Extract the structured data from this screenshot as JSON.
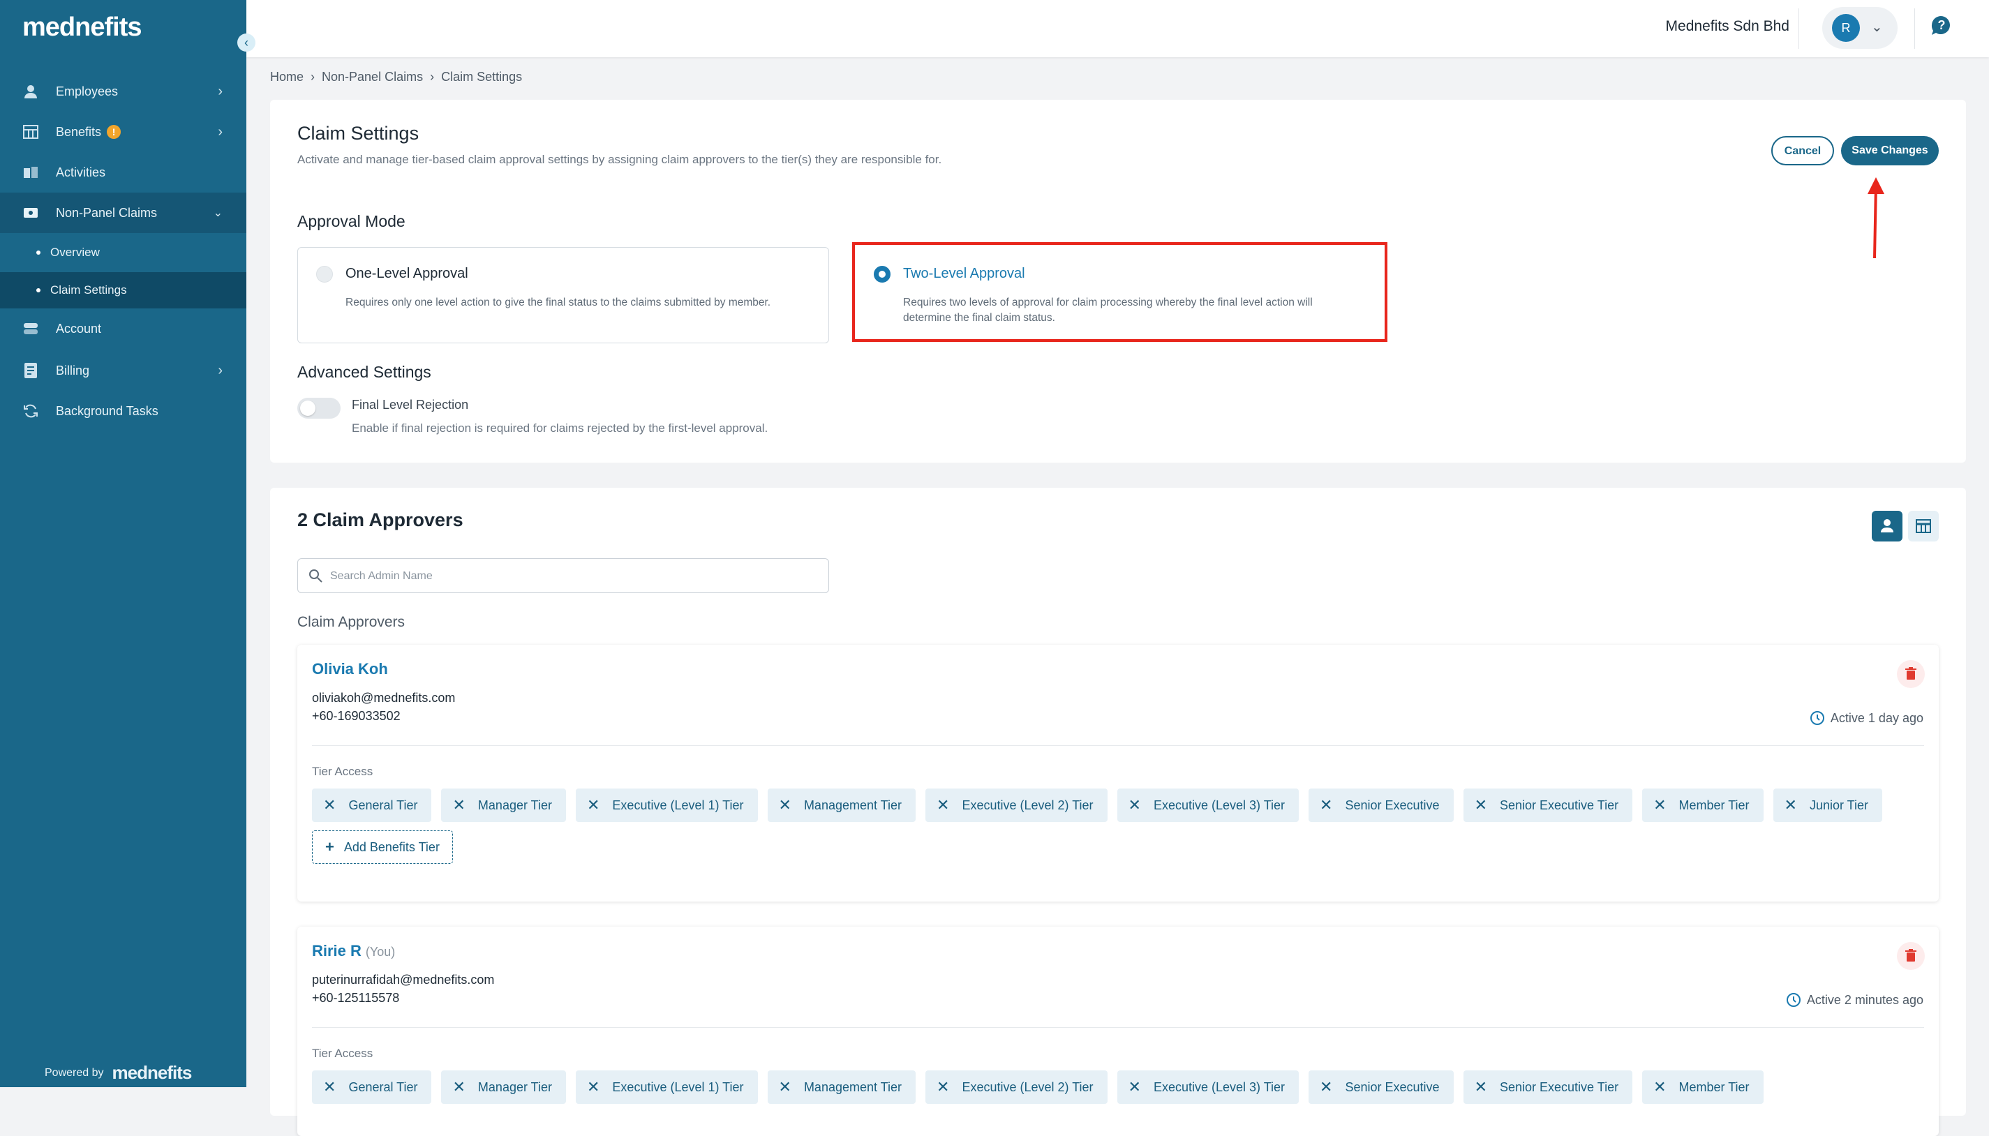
{
  "app": {
    "logo_text": "mednefits",
    "powered_by": "Powered by",
    "powered_brand": "mednefits"
  },
  "sidebar": {
    "items": [
      {
        "label": "Employees",
        "icon": "user-icon"
      },
      {
        "label": "Benefits",
        "icon": "benefits-icon",
        "badge": "!"
      },
      {
        "label": "Activities",
        "icon": "activities-icon"
      },
      {
        "label": "Non-Panel Claims",
        "icon": "wallet-icon"
      },
      {
        "label": "Account",
        "icon": "account-icon"
      },
      {
        "label": "Billing",
        "icon": "billing-icon"
      },
      {
        "label": "Background Tasks",
        "icon": "refresh-icon"
      }
    ],
    "subitems": [
      {
        "label": "Overview"
      },
      {
        "label": "Claim Settings"
      }
    ]
  },
  "topbar": {
    "company": "Mednefits Sdn Bhd",
    "avatar_initial": "R"
  },
  "breadcrumb": [
    "Home",
    "Non-Panel Claims",
    "Claim Settings"
  ],
  "settings": {
    "title": "Claim Settings",
    "description": "Activate and manage tier-based claim approval settings by assigning claim approvers to the tier(s) they are responsible for.",
    "cancel_label": "Cancel",
    "save_label": "Save Changes",
    "approval_mode_title": "Approval Mode",
    "modes": [
      {
        "title": "One-Level Approval",
        "description": "Requires only one level action to give the final status to the claims submitted by member.",
        "selected": false
      },
      {
        "title": "Two-Level Approval",
        "description": "Requires two levels of approval for claim processing whereby the final level action will determine the final claim status.",
        "selected": true
      }
    ],
    "advanced_title": "Advanced Settings",
    "final_rejection_title": "Final Level Rejection",
    "final_rejection_desc": "Enable if final rejection is required for claims rejected by the first-level approval.",
    "final_rejection_enabled": false
  },
  "approvers_section": {
    "title": "2 Claim Approvers",
    "search_placeholder": "Search Admin Name",
    "list_title": "Claim Approvers",
    "tier_access_label": "Tier Access",
    "add_tier_label": "Add Benefits Tier",
    "approvers": [
      {
        "name": "Olivia Koh",
        "you": "",
        "email": "oliviakoh@mednefits.com",
        "phone": "+60-169033502",
        "status": "Active 1 day ago",
        "tiers": [
          "General Tier",
          "Manager Tier",
          "Executive (Level 1) Tier",
          "Management Tier",
          "Executive (Level 2) Tier",
          "Executive (Level 3) Tier",
          "Senior Executive",
          "Senior Executive Tier",
          "Member Tier",
          "Junior Tier"
        ]
      },
      {
        "name": "Ririe R",
        "you": "(You)",
        "email": "puterinurrafidah@mednefits.com",
        "phone": "+60-125115578",
        "status": "Active 2 minutes ago",
        "tiers": [
          "General Tier",
          "Manager Tier",
          "Executive (Level 1) Tier",
          "Management Tier",
          "Executive (Level 2) Tier",
          "Executive (Level 3) Tier",
          "Senior Executive",
          "Senior Executive Tier",
          "Member Tier"
        ]
      }
    ]
  },
  "colors": {
    "primary": "#1a6789",
    "accent": "#1a7ab0",
    "highlight": "#e8261c",
    "sidebar": "#1a6789"
  }
}
